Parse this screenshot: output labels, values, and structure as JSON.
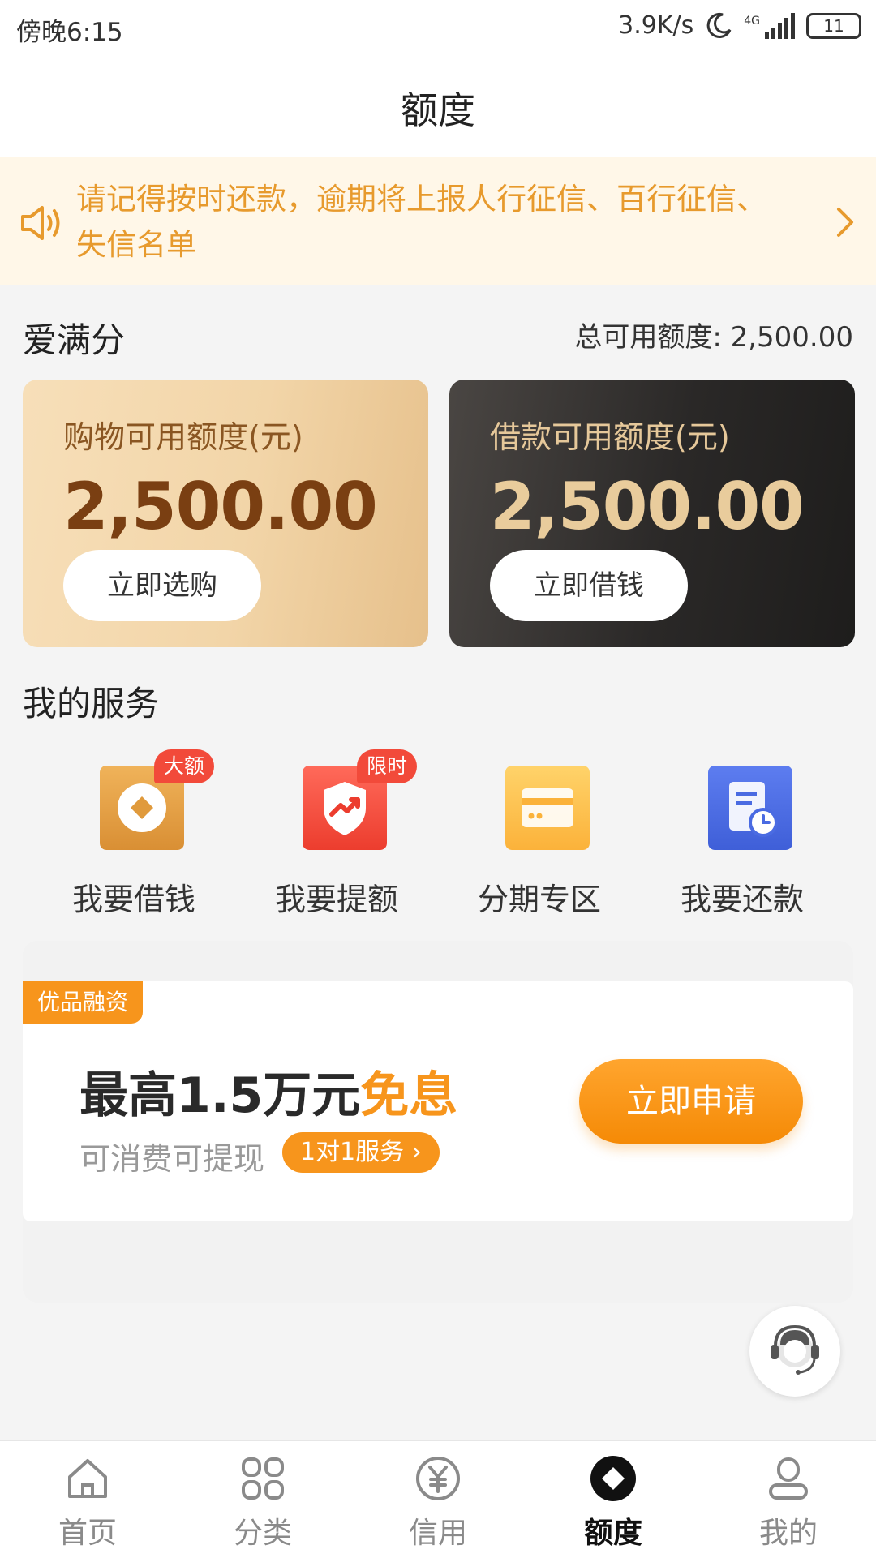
{
  "status_bar": {
    "time": "傍晚6:15",
    "net_speed": "3.9K/s",
    "network": "4G",
    "battery": "11"
  },
  "header": {
    "title": "额度"
  },
  "notice": {
    "text": "请记得按时还款，逾期将上报人行征信、百行征信、失信名单"
  },
  "limits": {
    "section_title": "爱满分",
    "total_label": "总可用额度: 2,500.00",
    "shopping": {
      "label": "购物可用额度(元)",
      "amount": "2,500.00",
      "button": "立即选购"
    },
    "loan": {
      "label": "借款可用额度(元)",
      "amount": "2,500.00",
      "button": "立即借钱"
    }
  },
  "services": {
    "title": "我的服务",
    "items": [
      {
        "label": "我要借钱",
        "badge": "大额",
        "icon": "coin-diamond-icon"
      },
      {
        "label": "我要提额",
        "badge": "限时",
        "icon": "shield-trend-icon"
      },
      {
        "label": "分期专区",
        "badge": "",
        "icon": "card-icon"
      },
      {
        "label": "我要还款",
        "badge": "",
        "icon": "bill-clock-icon"
      }
    ]
  },
  "promo": {
    "tag": "优品融资",
    "headline_main": "最高1.5万元",
    "headline_highlight": "免息",
    "sub": "可消费可提现",
    "service_pill": "1对1服务",
    "apply_button": "立即申请"
  },
  "bottom_nav": {
    "items": [
      {
        "label": "首页",
        "icon": "home-icon"
      },
      {
        "label": "分类",
        "icon": "grid-icon"
      },
      {
        "label": "信用",
        "icon": "yuan-circle-icon"
      },
      {
        "label": "额度",
        "icon": "diamond-circle-icon",
        "active": true
      },
      {
        "label": "我的",
        "icon": "profile-icon"
      }
    ]
  },
  "colors": {
    "accent_orange": "#f7951c",
    "notice_text": "#e79a2d",
    "badge_red": "#f24a3a",
    "gold_amount": "#7a3f12"
  }
}
